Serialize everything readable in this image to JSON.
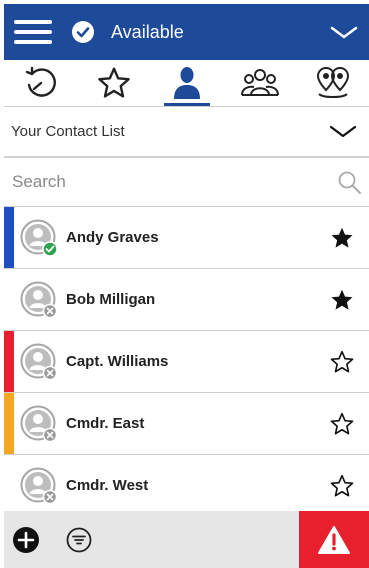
{
  "header": {
    "status": "Available",
    "colors": {
      "bar": "#1e4a9a",
      "text": "#ffffff"
    }
  },
  "tabs": [
    {
      "name": "recent",
      "icon": "history-icon",
      "active": false
    },
    {
      "name": "favorites",
      "icon": "star-outline-icon",
      "active": false
    },
    {
      "name": "contacts",
      "icon": "person-icon",
      "active": true
    },
    {
      "name": "groups",
      "icon": "group-icon",
      "active": false
    },
    {
      "name": "locations",
      "icon": "map-pins-icon",
      "active": false
    }
  ],
  "contact_list": {
    "selected": "Your Contact List"
  },
  "search": {
    "placeholder": "Search",
    "value": ""
  },
  "contacts": [
    {
      "name": "Andy Graves",
      "status": "online",
      "favorite": true,
      "bar_color": "#1e4fc0"
    },
    {
      "name": "Bob Milligan",
      "status": "offline",
      "favorite": true,
      "bar_color": ""
    },
    {
      "name": "Capt. Williams",
      "status": "offline",
      "favorite": false,
      "bar_color": "#e8202e"
    },
    {
      "name": "Cmdr. East",
      "status": "offline",
      "favorite": false,
      "bar_color": "#f5a623"
    },
    {
      "name": "Cmdr. West",
      "status": "offline",
      "favorite": false,
      "bar_color": ""
    }
  ],
  "footer": {
    "add_icon": "plus-circle-icon",
    "filter_icon": "filter-icon",
    "alert_icon": "warning-icon",
    "alert_color": "#e8202e"
  }
}
